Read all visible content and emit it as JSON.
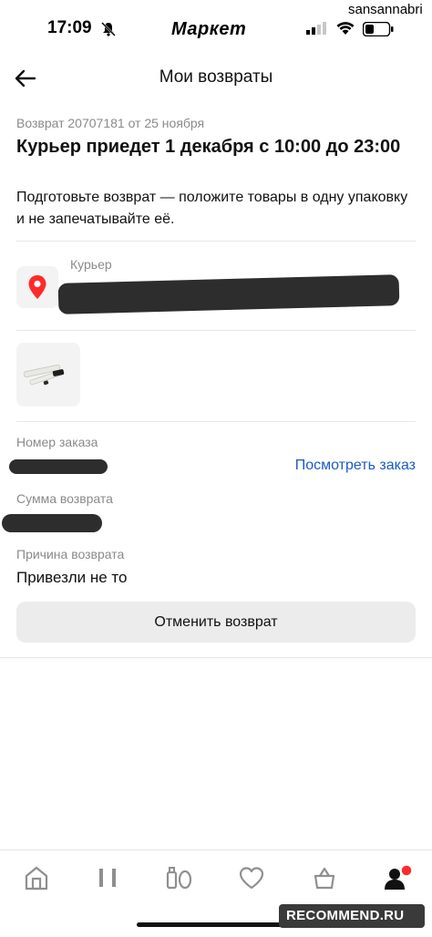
{
  "status_bar": {
    "time": "17:09",
    "brand": "Маркет",
    "watermark_user": "sansannabri"
  },
  "header": {
    "title": "Мои возвраты"
  },
  "return": {
    "meta": "Возврат 20707181 от 25 ноября",
    "headline": "Курьер приедет 1 декабря с 10:00 до 23:00",
    "instructions": "Подготовьте возврат — положите товары в одну упаковку и не запечатывайте её.",
    "courier_label": "Курьер",
    "order_number_label": "Номер заказа",
    "view_order_link": "Посмотреть заказ",
    "refund_sum_label": "Сумма возврата",
    "reason_label": "Причина возврата",
    "reason_value": "Привезли не то",
    "cancel_button": "Отменить возврат"
  },
  "tab_bar": {
    "items": [
      "home-icon",
      "catalog-icon",
      "products-icon",
      "favorites-icon",
      "cart-icon",
      "profile-icon"
    ],
    "active_badge_color": "#ff2a2a"
  },
  "watermark": {
    "text": "RECOMMEND.RU"
  },
  "colors": {
    "link": "#1a5bc4",
    "pin": "#ff2a2a",
    "muted_text": "#8a8a8a"
  }
}
